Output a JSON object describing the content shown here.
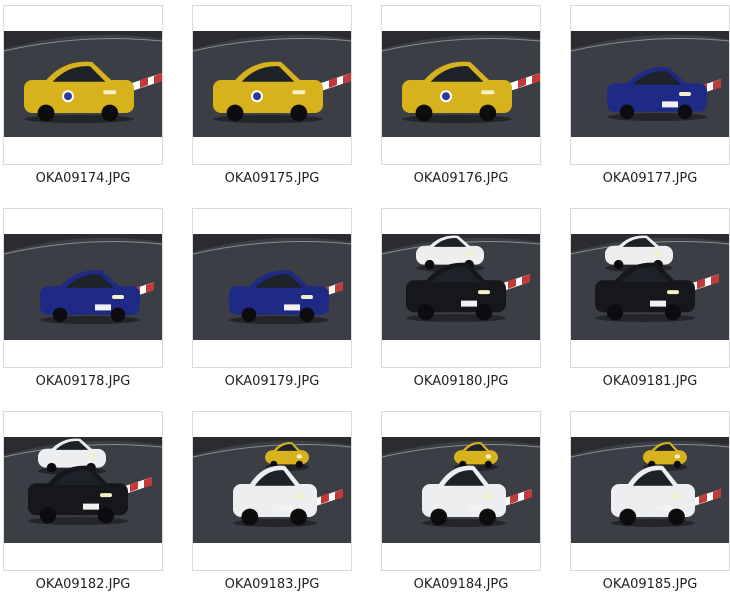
{
  "thumbnails": [
    {
      "filename": "OKA09174.JPG",
      "scene": "yellow-hatchback-91"
    },
    {
      "filename": "OKA09175.JPG",
      "scene": "yellow-hatchback-91"
    },
    {
      "filename": "OKA09176.JPG",
      "scene": "yellow-hatchback-91"
    },
    {
      "filename": "OKA09177.JPG",
      "scene": "blue-roadster"
    },
    {
      "filename": "OKA09178.JPG",
      "scene": "blue-roadster"
    },
    {
      "filename": "OKA09179.JPG",
      "scene": "blue-roadster"
    },
    {
      "filename": "OKA09180.JPG",
      "scene": "black-coupe-white-sedan"
    },
    {
      "filename": "OKA09181.JPG",
      "scene": "black-coupe-white-sedan"
    },
    {
      "filename": "OKA09182.JPG",
      "scene": "black-coupe-white-sedan"
    },
    {
      "filename": "OKA09183.JPG",
      "scene": "white-sedan-yellow-car"
    },
    {
      "filename": "OKA09184.JPG",
      "scene": "white-sedan-yellow-car"
    },
    {
      "filename": "OKA09185.JPG",
      "scene": "white-sedan-yellow-car"
    }
  ],
  "colors": {
    "track": "#3b3e44",
    "yellow_car": "#d8b21c",
    "blue_car": "#1e2a86",
    "black_car": "#16171b",
    "white_car": "#eceef0",
    "curb_red": "#c23a3a"
  }
}
